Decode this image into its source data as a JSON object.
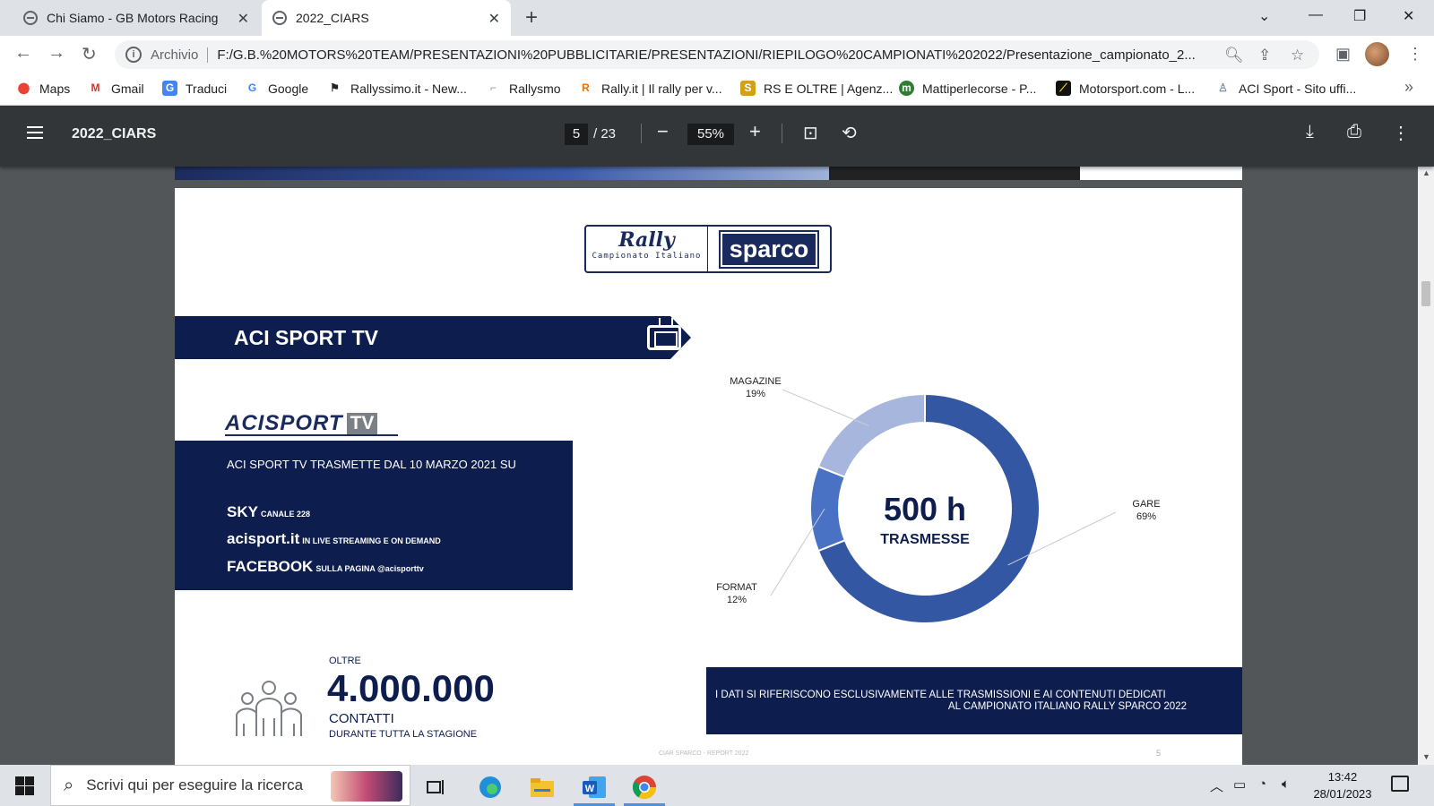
{
  "browser": {
    "tabs": [
      {
        "title": "Chi Siamo - GB Motors Racing",
        "active": false
      },
      {
        "title": "2022_CIARS",
        "active": true
      }
    ],
    "address": {
      "scheme": "Archivio",
      "url": "F:/G.B.%20MOTORS%20TEAM/PRESENTAZIONI%20PUBBLICITARIE/PRESENTAZIONI/RIEPILOGO%20CAMPIONATI%202022/Presentazione_campionato_2..."
    },
    "bookmarks": [
      {
        "label": "Maps",
        "icon": "maps-pin-icon",
        "color": "#ea4335"
      },
      {
        "label": "Gmail",
        "icon": "gmail-icon",
        "color": "#d93025"
      },
      {
        "label": "Traduci",
        "icon": "translate-icon",
        "color": "#4285f4"
      },
      {
        "label": "Google",
        "icon": "google-icon",
        "color": "#4285f4"
      },
      {
        "label": "Rallyssimo.it - New...",
        "icon": "checkered-flag-icon",
        "color": "#222222"
      },
      {
        "label": "Rallysmo",
        "icon": "rallysmo-icon",
        "color": "#999999"
      },
      {
        "label": "Rally.it | Il rally per v...",
        "icon": "rally-r-icon",
        "color": "#e8710a"
      },
      {
        "label": "RS E OLTRE | Agenz...",
        "icon": "rs-icon",
        "color": "#d4a017"
      },
      {
        "label": "Mattiperlecorse - P...",
        "icon": "mattiperlecorse-icon",
        "color": "#2e7d32"
      },
      {
        "label": "Motorsport.com - L...",
        "icon": "motorsport-icon",
        "color": "#111111"
      },
      {
        "label": "ACI Sport - Sito uffi...",
        "icon": "aci-icon",
        "color": "#7a8fb8"
      }
    ]
  },
  "pdf": {
    "title": "2022_CIARS",
    "page": "5",
    "total": "/ 23",
    "zoom": "55%"
  },
  "slide": {
    "logo": {
      "rally": "Rally",
      "subtitle": "Campionato Italiano",
      "sponsor": "sparco"
    },
    "banner_title": "ACI SPORT TV",
    "acitv_brand": "ACISPORT",
    "acitv_suffix": "TV",
    "info_intro": "ACI SPORT TV TRASMETTE DAL 10 MARZO 2021 SU",
    "channels": [
      {
        "name": "SKY",
        "detail": "CANALE 228"
      },
      {
        "name": "acisport.it",
        "detail": "IN LIVE STREAMING E ON DEMAND"
      },
      {
        "name": "FACEBOOK",
        "detail": "SULLA PAGINA @acisporttv"
      }
    ],
    "oltre": "OLTRE",
    "contacts_number": "4.000.000",
    "contacts_label": "CONTATTI",
    "contacts_sub": "DURANTE TUTTA LA STAGIONE",
    "center_value": "500 h",
    "center_label": "TRASMESSE",
    "note_line1": "I DATI SI RIFERISCONO ESCLUSIVAMENTE ALLE TRASMISSIONI E AI CONTENUTI DEDICATI",
    "note_line2": "AL CAMPIONATO ITALIANO RALLY SPARCO 2022",
    "footer": "CIAR SPARCO - REPORT 2022",
    "page_number": "5"
  },
  "chart_data": {
    "type": "pie",
    "title": "",
    "categories": [
      "GARE",
      "FORMAT",
      "MAGAZINE"
    ],
    "values": [
      69,
      12,
      19
    ],
    "labels": [
      "69%",
      "12%",
      "19%"
    ],
    "colors": [
      "#3457a3",
      "#4a72c4",
      "#a6b6dc"
    ]
  },
  "taskbar": {
    "search_placeholder": "Scrivi qui per eseguire la ricerca",
    "time": "13:42",
    "date": "28/01/2023"
  }
}
